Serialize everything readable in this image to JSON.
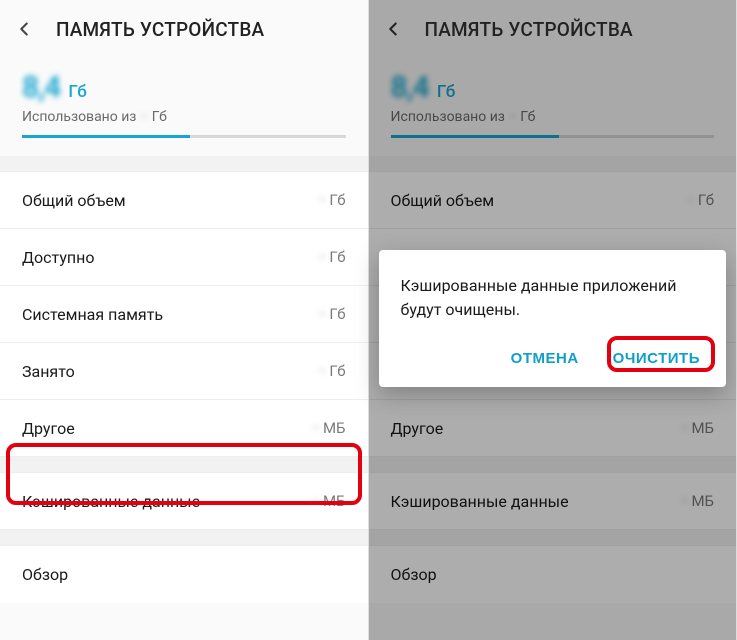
{
  "header": {
    "title": "ПАМЯТЬ УСТРОЙСТВА"
  },
  "summary": {
    "used_value": "8,4",
    "used_unit": "Гб",
    "subtitle_prefix": "Использовано из",
    "total_value": "··",
    "total_unit": "Гб"
  },
  "rows": [
    {
      "label": "Общий объем",
      "value": "··",
      "unit": "Гб"
    },
    {
      "label": "Доступно",
      "value": "··",
      "unit": "Гб"
    },
    {
      "label": "Системная память",
      "value": "··",
      "unit": "Гб"
    },
    {
      "label": "Занято",
      "value": "··",
      "unit": "Гб"
    },
    {
      "label": "Другое",
      "value": "··",
      "unit": "МБ"
    },
    {
      "label": "Кэшированные данные",
      "value": "··",
      "unit": "МБ"
    },
    {
      "label": "Обзор",
      "value": "",
      "unit": ""
    }
  ],
  "dialog": {
    "message": "Кэшированные данные приложений будут очищены.",
    "cancel": "ОТМЕНА",
    "confirm": "ОЧИСТИТЬ"
  }
}
